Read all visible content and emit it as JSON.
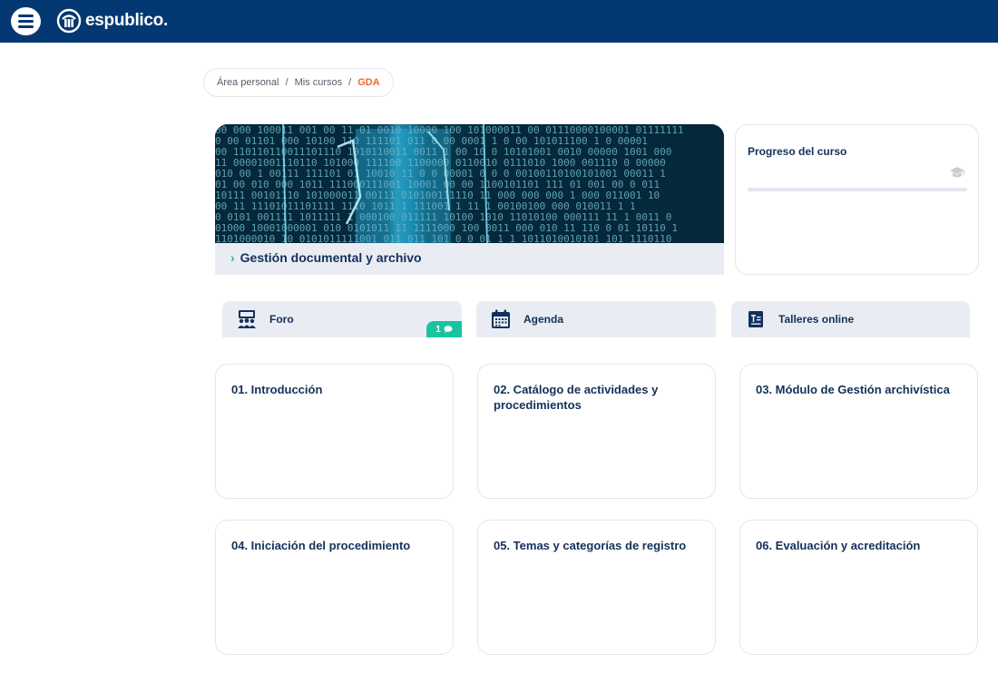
{
  "header": {
    "logo_text": "espublico."
  },
  "breadcrumb": {
    "items": [
      "Área personal",
      "Mis cursos"
    ],
    "separator": "/",
    "current": "GDA"
  },
  "course": {
    "title": "Gestión documental y archivo",
    "chevron": "›"
  },
  "progress": {
    "title": "Progreso del curso",
    "percent": 0
  },
  "tools": [
    {
      "label": "Foro",
      "icon": "people-group-icon",
      "badge_count": "1"
    },
    {
      "label": "Agenda",
      "icon": "calendar-icon"
    },
    {
      "label": "Talleres online",
      "icon": "workshop-icon"
    }
  ],
  "modules": [
    {
      "title": "01. Introducción"
    },
    {
      "title": "02. Catálogo de actividades y procedimientos"
    },
    {
      "title": "03. Módulo de Gestión archivística"
    },
    {
      "title": "04. Iniciación del procedimiento"
    },
    {
      "title": "05. Temas y categorías de registro"
    },
    {
      "title": "06. Evaluación y acreditación"
    }
  ],
  "colors": {
    "topbar": "#043872",
    "accent": "#f26b21",
    "teal": "#18b3c8",
    "badge": "#16c5a0",
    "text_dark": "#14305a"
  }
}
